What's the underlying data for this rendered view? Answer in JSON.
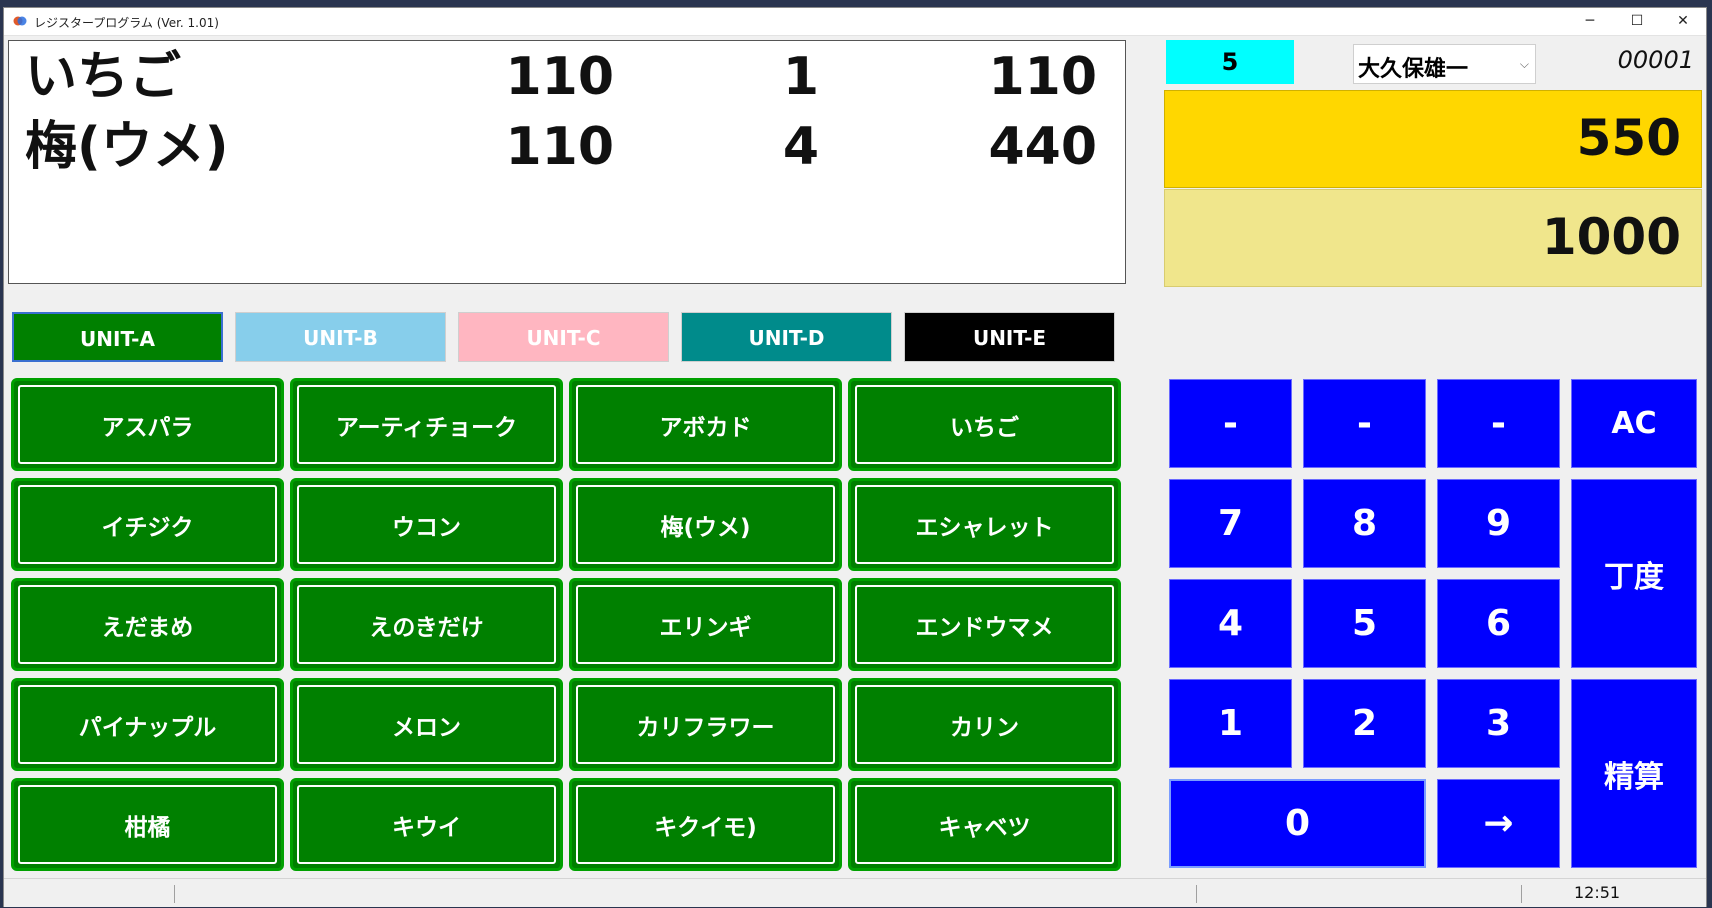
{
  "window": {
    "title": "レジスタープログラム (Ver. 1.01)",
    "controls": {
      "minimize": "─",
      "maximize": "☐",
      "close": "✕"
    }
  },
  "receipt": {
    "rows": [
      {
        "name": "いちご",
        "price": "110",
        "qty": "1",
        "total": "110"
      },
      {
        "name": "梅(ウメ)",
        "price": "110",
        "qty": "4",
        "total": "440"
      }
    ]
  },
  "header": {
    "count": "5",
    "staff_select": "大久保雄一",
    "receipt_no": "00001"
  },
  "totals": {
    "amount": "550",
    "tendered": "1000"
  },
  "units": [
    {
      "label": "UNIT-A",
      "bg": "#008000",
      "fg": "#ffffff"
    },
    {
      "label": "UNIT-B",
      "bg": "#87ceeb",
      "fg": "#ffffff"
    },
    {
      "label": "UNIT-C",
      "bg": "#ffb6c1",
      "fg": "#ffffff"
    },
    {
      "label": "UNIT-D",
      "bg": "#008b8b",
      "fg": "#ffffff"
    },
    {
      "label": "UNIT-E",
      "bg": "#000000",
      "fg": "#ffffff"
    }
  ],
  "products": [
    "アスパラ",
    "アーティチョーク",
    "アボカド",
    "いちご",
    "イチジク",
    "ウコン",
    "梅(ウメ)",
    "エシャレット",
    "えだまめ",
    "えのきだけ",
    "エリンギ",
    "エンドウマメ",
    "パイナップル",
    "メロン",
    "カリフラワー",
    "カリン",
    "柑橘",
    "キウイ",
    "キクイモ)",
    "キャベツ"
  ],
  "keypad": {
    "dash1": "-",
    "dash2": "-",
    "dash3": "-",
    "ac": "AC",
    "k7": "7",
    "k8": "8",
    "k9": "9",
    "exact": "丁度",
    "k4": "4",
    "k5": "5",
    "k6": "6",
    "k1": "1",
    "k2": "2",
    "k3": "3",
    "settle": "精算",
    "k0": "0",
    "arrow": "→"
  },
  "status": {
    "time": "12:51"
  },
  "colors": {
    "count_bg": "#00ffff",
    "amount_bg": "#ffd700",
    "tendered_bg": "#f0e68c",
    "key_bg": "#0000ff",
    "product_bg": "#008000"
  }
}
